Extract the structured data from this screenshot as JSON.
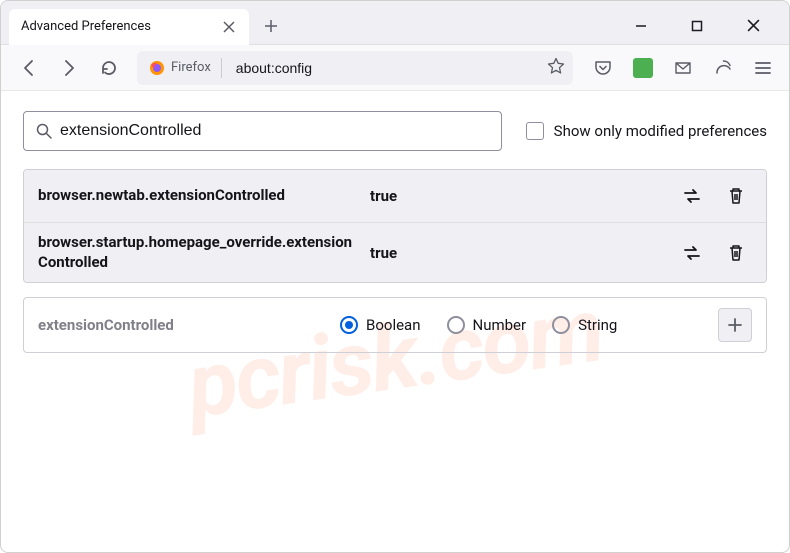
{
  "window": {
    "tab_title": "Advanced Preferences",
    "url_identity": "Firefox",
    "url": "about:config"
  },
  "config": {
    "search_value": "extensionControlled",
    "show_modified_label": "Show only modified preferences",
    "new_pref_name": "extensionControlled"
  },
  "results": [
    {
      "name": "browser.newtab.extensionControlled",
      "value": "true"
    },
    {
      "name": "browser.startup.homepage_override.extensionControlled",
      "value": "true"
    }
  ],
  "types": {
    "boolean": "Boolean",
    "number": "Number",
    "string": "String"
  },
  "watermark": "pcrisk.com"
}
